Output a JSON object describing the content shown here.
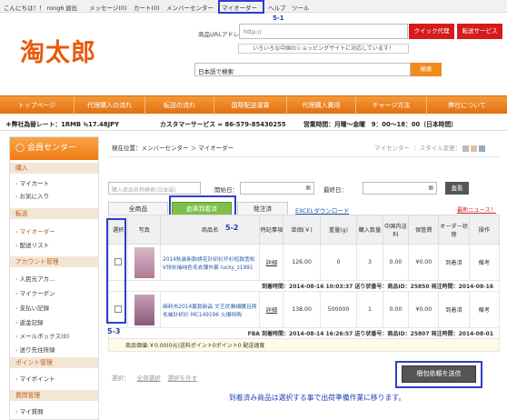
{
  "topbar": {
    "greeting": "こんにちは！！ rong6",
    "logout": "退出",
    "messages": "メッセージ(0)",
    "cart": "カート(0)",
    "member_center": "メンバーセンター",
    "my_order": "マイオーダー",
    "help": "ヘルプ",
    "tools": "ツール"
  },
  "annotations": {
    "a1": "5-1",
    "a2": "5-2",
    "a3": "5-3"
  },
  "header": {
    "logo": "淘太郎",
    "url_label": "商品URLアドレ",
    "url_value": "http://",
    "quick_btn": "クイック代理",
    "forward_btn": "転送サービス",
    "notice": "いろいろな中国のショッピングサイトに対応しています！",
    "search_value": "日本語で検索",
    "search_btn": "検索"
  },
  "nav": [
    "トップページ",
    "代理購入の流れ",
    "転送の流れ",
    "国際配送運賃",
    "代理購入費用",
    "チャージ方法",
    "弊社について"
  ],
  "info": {
    "rate": "＊弊社為替レート：1RMB ≒17.48JPY",
    "service": "カスタマーサービス ≈ 86-579-85430255",
    "hours": "営業時間：月曜～金曜　9：00～18：00（日本時間）"
  },
  "sidebar": {
    "title": "会員センター",
    "sections": [
      {
        "title": "購入",
        "items": [
          "マイカート",
          "お気に入り"
        ]
      },
      {
        "title": "転送",
        "items": [
          "マイオーダー",
          "配送リスト"
        ]
      },
      {
        "title": "アカウント管理",
        "items": [
          "人民元アカ…",
          "マイクーポン",
          "支払い記録",
          "返金記録",
          "メールボックス(0)",
          "送り先住所録"
        ]
      },
      {
        "title": "ポイント管理",
        "items": [
          "マイポイント"
        ]
      },
      {
        "title": "質問管理",
        "items": [
          "マイ質問"
        ]
      }
    ]
  },
  "crumb": {
    "text": "現在位置：メンバーセンター ＞ マイオーダー",
    "right": "マイセンター ｜ スタイル変更："
  },
  "filter": {
    "search_placeholder": "購入商品名称検索(日本語)",
    "start_label": "開始日：",
    "end_label": "最終日：",
    "query_btn": "査看"
  },
  "tabs": {
    "all": "全商品",
    "arrived": "倉庫到着済",
    "shipped": "発注済",
    "excel": "EXCELダウンロード",
    "latest": "最新ニュース！"
  },
  "table": {
    "headers": [
      "選択",
      "写真",
      "商品名",
      "特記事項",
      "単価(￥)",
      "重量(g)",
      "購入数量",
      "中国内送料",
      "保管費",
      "オーダー状態",
      "操作"
    ],
    "rows": [
      {
        "name": "2014秋装新款绣花针织衫开衫短款宽松V领长袖纯色毛衣薄外套 lucky_z1991",
        "note": "詳細",
        "price": "126.00",
        "weight": "0",
        "qty": "3",
        "shipping": "0.00",
        "storage": "¥0.00",
        "status": "到着済",
        "op": "備考",
        "detail": "到着時間：2014-08-16 10:03:37 送り状番号：商品ID：25850 発注時間：2014-08-16"
      },
      {
        "name": "麻利市2014夏款新品 文艺优雅细腰且两毛袖针织衫 MC149196 火爆特购",
        "note": "詳細",
        "price": "138.00",
        "weight": "500000",
        "qty": "1",
        "shipping": "0.00",
        "storage": "¥0.00",
        "status": "到着済",
        "op": "備考",
        "detail": "FBA 到着時間：2014-08-14 16:26:57 送り状番号：商品ID：25807 発注時間：2014-08-01"
      }
    ],
    "summary": "商品価値:￥0.00(0元)送料ポイント0ポイント0 配送速度"
  },
  "footer": {
    "select_label": "選択：",
    "select_all": "全部選択",
    "deselect": "選択を外す",
    "pack_btn": "梱包依頼を送信",
    "note": "到着済み商品は選択する事で出荷準備作業に移ります。"
  },
  "colors": {
    "accent": "#e36e10",
    "highlight": "#2f3fc8",
    "danger": "#d41c1c"
  }
}
